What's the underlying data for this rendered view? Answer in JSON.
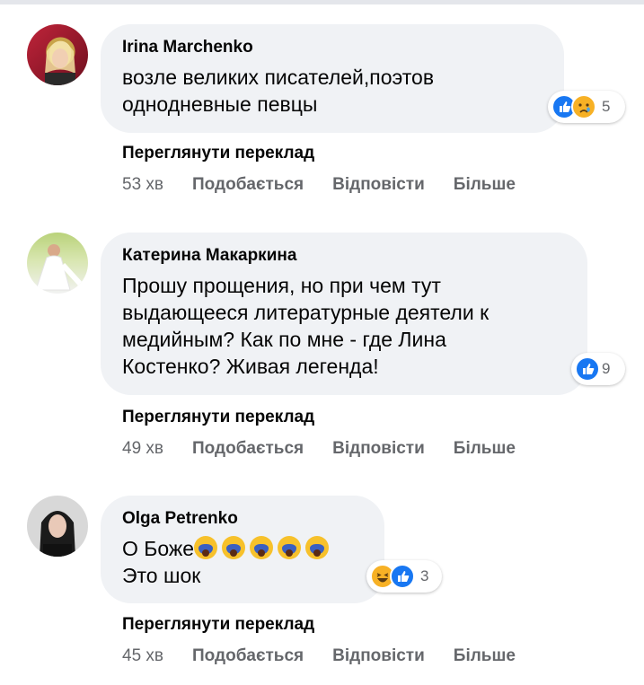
{
  "comments": [
    {
      "author": "Irina Marchenko",
      "text": "возле великих писателей,поэтов\nоднодневные певцы",
      "reaction_count": "5",
      "translate": "Переглянути переклад",
      "time": "53 хв",
      "like": "Подобається",
      "reply": "Відповісти",
      "more": "Більше"
    },
    {
      "author": "Катерина Макаркина",
      "text": "Прошу прощения, но при чем тут\nвыдающееся литературные деятели к\nмедийным? Как по мне - где Лина\nКостенко? Живая легенда!",
      "reaction_count": "9",
      "translate": "Переглянути переклад",
      "time": "49 хв",
      "like": "Подобається",
      "reply": "Відповісти",
      "more": "Більше"
    },
    {
      "author": "Olga Petrenko",
      "text_line1": "О Боже",
      "text_line2": "Это шок",
      "reaction_count": "3",
      "translate": "Переглянути переклад",
      "time": "45 хв",
      "like": "Подобається",
      "reply": "Відповісти",
      "more": "Більше"
    }
  ],
  "colors": {
    "bubble": "#f0f2f5",
    "like": "#1877f2",
    "emoji": "#f7b125",
    "muted": "#65676b"
  }
}
